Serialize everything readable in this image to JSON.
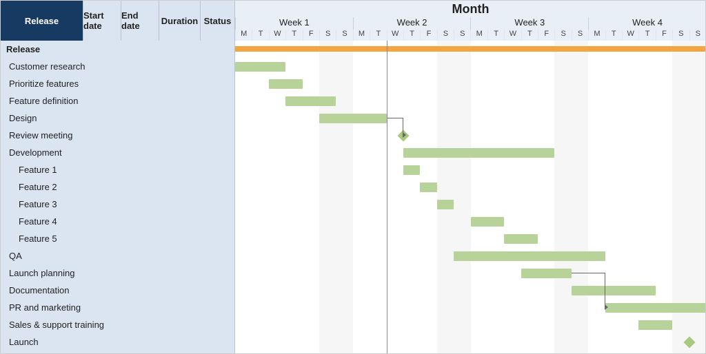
{
  "header": {
    "release": "Release",
    "start_date": "Start date",
    "end_date": "End date",
    "duration": "Duration",
    "status": "Status",
    "month": "Month",
    "weeks": [
      "Week 1",
      "Week 2",
      "Week 3",
      "Week 4"
    ],
    "days": [
      "M",
      "T",
      "W",
      "T",
      "F",
      "S",
      "S",
      "M",
      "T",
      "W",
      "T",
      "F",
      "S",
      "S",
      "M",
      "T",
      "W",
      "T",
      "F",
      "S",
      "S",
      "M",
      "T",
      "W",
      "T",
      "F",
      "S",
      "S"
    ]
  },
  "colors": {
    "summary": "#f2a541",
    "bar": "#b8d39a",
    "header_dark": "#173a63",
    "header_light": "#dbe5f1"
  },
  "tasks": [
    {
      "id": "release",
      "label": "Release",
      "kind": "summary",
      "indent": 0,
      "start": 0,
      "end": 28
    },
    {
      "id": "customer-research",
      "label": "Customer research",
      "kind": "bar",
      "indent": 1,
      "start": 0,
      "end": 3
    },
    {
      "id": "prioritize-features",
      "label": "Prioritize features",
      "kind": "bar",
      "indent": 1,
      "start": 2,
      "end": 4
    },
    {
      "id": "feature-definition",
      "label": "Feature definition",
      "kind": "bar",
      "indent": 1,
      "start": 3,
      "end": 6
    },
    {
      "id": "design",
      "label": "Design",
      "kind": "bar",
      "indent": 1,
      "start": 5,
      "end": 9
    },
    {
      "id": "review-meeting",
      "label": "Review meeting",
      "kind": "milestone",
      "indent": 1,
      "at": 10
    },
    {
      "id": "development",
      "label": "Development",
      "kind": "bar",
      "indent": 1,
      "start": 10,
      "end": 19
    },
    {
      "id": "feature-1",
      "label": "Feature 1",
      "kind": "bar",
      "indent": 2,
      "start": 10,
      "end": 11
    },
    {
      "id": "feature-2",
      "label": "Feature 2",
      "kind": "bar",
      "indent": 2,
      "start": 11,
      "end": 12
    },
    {
      "id": "feature-3",
      "label": "Feature 3",
      "kind": "bar",
      "indent": 2,
      "start": 12,
      "end": 13
    },
    {
      "id": "feature-4",
      "label": "Feature 4",
      "kind": "bar",
      "indent": 2,
      "start": 14,
      "end": 16
    },
    {
      "id": "feature-5",
      "label": "Feature 5",
      "kind": "bar",
      "indent": 2,
      "start": 16,
      "end": 18
    },
    {
      "id": "qa",
      "label": "QA",
      "kind": "bar",
      "indent": 1,
      "start": 13,
      "end": 22
    },
    {
      "id": "launch-planning",
      "label": "Launch planning",
      "kind": "bar",
      "indent": 1,
      "start": 17,
      "end": 20
    },
    {
      "id": "documentation",
      "label": "Documentation",
      "kind": "bar",
      "indent": 1,
      "start": 20,
      "end": 25
    },
    {
      "id": "pr-marketing",
      "label": "PR and  marketing",
      "kind": "bar",
      "indent": 1,
      "start": 22,
      "end": 28
    },
    {
      "id": "sales-support-training",
      "label": "Sales & support training",
      "kind": "bar",
      "indent": 1,
      "start": 24,
      "end": 26
    },
    {
      "id": "launch",
      "label": "Launch",
      "kind": "milestone",
      "indent": 1,
      "at": 27
    }
  ],
  "dependencies": [
    {
      "from": "design",
      "to": "review-meeting"
    },
    {
      "from": "launch-planning",
      "to": "pr-marketing"
    }
  ],
  "chart_data": {
    "type": "gantt",
    "title": "Month",
    "time_unit": "day",
    "x_range": [
      0,
      28
    ],
    "columns": [
      "Week 1",
      "Week 2",
      "Week 3",
      "Week 4"
    ],
    "day_labels": [
      "M",
      "T",
      "W",
      "T",
      "F",
      "S",
      "S"
    ],
    "series": [
      {
        "name": "Release",
        "type": "summary",
        "start": 0,
        "end": 28
      },
      {
        "name": "Customer research",
        "type": "task",
        "start": 0,
        "end": 3
      },
      {
        "name": "Prioritize features",
        "type": "task",
        "start": 2,
        "end": 4
      },
      {
        "name": "Feature definition",
        "type": "task",
        "start": 3,
        "end": 6
      },
      {
        "name": "Design",
        "type": "task",
        "start": 5,
        "end": 9
      },
      {
        "name": "Review meeting",
        "type": "milestone",
        "start": 10,
        "end": 10
      },
      {
        "name": "Development",
        "type": "task",
        "start": 10,
        "end": 19
      },
      {
        "name": "Feature 1",
        "type": "task",
        "start": 10,
        "end": 11,
        "parent": "Development"
      },
      {
        "name": "Feature 2",
        "type": "task",
        "start": 11,
        "end": 12,
        "parent": "Development"
      },
      {
        "name": "Feature 3",
        "type": "task",
        "start": 12,
        "end": 13,
        "parent": "Development"
      },
      {
        "name": "Feature 4",
        "type": "task",
        "start": 14,
        "end": 16,
        "parent": "Development"
      },
      {
        "name": "Feature 5",
        "type": "task",
        "start": 16,
        "end": 18,
        "parent": "Development"
      },
      {
        "name": "QA",
        "type": "task",
        "start": 13,
        "end": 22
      },
      {
        "name": "Launch planning",
        "type": "task",
        "start": 17,
        "end": 20
      },
      {
        "name": "Documentation",
        "type": "task",
        "start": 20,
        "end": 25
      },
      {
        "name": "PR and  marketing",
        "type": "task",
        "start": 22,
        "end": 28
      },
      {
        "name": "Sales & support training",
        "type": "task",
        "start": 24,
        "end": 26
      },
      {
        "name": "Launch",
        "type": "milestone",
        "start": 27,
        "end": 27
      }
    ],
    "dependencies": [
      {
        "from": "Design",
        "to": "Review meeting"
      },
      {
        "from": "Launch planning",
        "to": "PR and  marketing"
      }
    ]
  }
}
